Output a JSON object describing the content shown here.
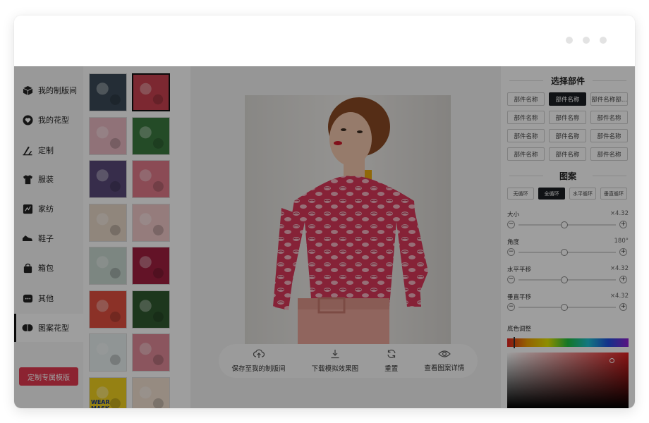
{
  "nav": {
    "items": [
      {
        "label": "我的制版间",
        "icon": "cube-icon"
      },
      {
        "label": "我的花型",
        "icon": "heart-icon"
      },
      {
        "label": "定制",
        "icon": "pen-ruler-icon"
      },
      {
        "label": "服装",
        "icon": "tshirt-icon"
      },
      {
        "label": "家纺",
        "icon": "textile-icon"
      },
      {
        "label": "鞋子",
        "icon": "shoe-icon"
      },
      {
        "label": "箱包",
        "icon": "bag-icon"
      },
      {
        "label": "其他",
        "icon": "more-icon"
      },
      {
        "label": "图案花型",
        "icon": "pattern-icon",
        "active": true
      }
    ],
    "cta_label": "定制专属模版"
  },
  "thumbnails": {
    "selected_index": 1,
    "colors": [
      "#3a4a58",
      "#c9424f",
      "#e9b8c2",
      "#3b7a3f",
      "#5a4a7a",
      "#e07a8a",
      "#e8d8c8",
      "#f0c8c8",
      "#c8d8d0",
      "#a02040",
      "#e05040",
      "#2f5a2f",
      "#e8f0f0",
      "#e08a98",
      "#f0d020",
      "#f2e0d0"
    ],
    "thumb_text": "WEAR MASK"
  },
  "toolbar": {
    "save_label": "保存至我的制版间",
    "download_label": "下载模拟效果图",
    "reset_label": "重置",
    "details_label": "查看图案详情"
  },
  "panel": {
    "parts_title": "选择部件",
    "parts": [
      "部件名称",
      "部件名称",
      "部件名称部...",
      "部件名称",
      "部件名称",
      "部件名称",
      "部件名称",
      "部件名称",
      "部件名称",
      "部件名称",
      "部件名称",
      "部件名称"
    ],
    "parts_active_index": 1,
    "pattern_title": "图案",
    "modes": [
      "无循环",
      "全循环",
      "水平循环",
      "垂直循环"
    ],
    "modes_active_index": 1,
    "sliders": [
      {
        "label": "大小",
        "value": "×4.32",
        "level": 0.47
      },
      {
        "label": "角度",
        "value": "180°",
        "level": 0.47
      },
      {
        "label": "水平平移",
        "value": "×4.32",
        "level": 0.47
      },
      {
        "label": "垂直平移",
        "value": "×4.32",
        "level": 0.47
      }
    ],
    "color_title": "底色调整"
  }
}
